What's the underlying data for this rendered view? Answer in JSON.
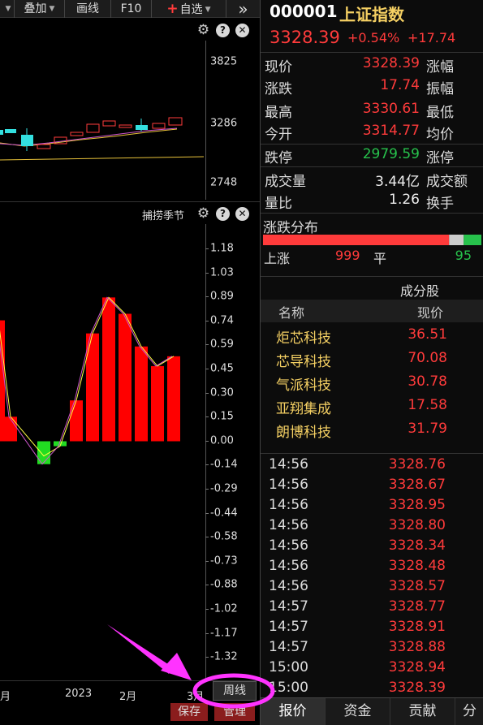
{
  "toolbar": {
    "overlay_label": "叠加",
    "draw_label": "画线",
    "f10_label": "F10",
    "watchlist_label": "自选",
    "more_glyph": "»"
  },
  "kline": {
    "price_labels": [
      "3825",
      "3286",
      "2748"
    ]
  },
  "indicator": {
    "name": "捕捞季节",
    "axis_labels": [
      "1.18",
      "1.03",
      "0.89",
      "0.74",
      "0.59",
      "0.45",
      "0.30",
      "0.15",
      "0.00",
      "-0.14",
      "-0.29",
      "-0.44",
      "-0.58",
      "-0.73",
      "-0.88",
      "-1.02",
      "-1.17",
      "-1.32"
    ]
  },
  "chart_data": {
    "type": "bar",
    "series": [
      {
        "values": [
          0.74,
          0.15,
          -0.14,
          -0.03,
          0.25,
          0.66,
          0.88,
          0.78,
          0.58,
          0.46,
          0.52
        ]
      }
    ],
    "ylim": [
      -1.32,
      1.18
    ]
  },
  "xaxis": {
    "labels": [
      "月",
      "2023",
      "2月",
      "3月"
    ]
  },
  "period_button": "周线",
  "save_button": "保存",
  "manage_button": "管理",
  "quote": {
    "code": "000001",
    "name": "上证指数",
    "price": "3328.39",
    "change_pct": "+0.54%",
    "change_amt": "+17.74",
    "rows": [
      {
        "label": "现价",
        "value": "3328.39",
        "color": "red",
        "label2": "涨幅"
      },
      {
        "label": "涨跌",
        "value": "17.74",
        "color": "red",
        "label2": "振幅"
      },
      {
        "label": "最高",
        "value": "3330.61",
        "color": "red",
        "label2": "最低"
      },
      {
        "label": "今开",
        "value": "3314.77",
        "color": "red",
        "label2": "均价"
      },
      {
        "label": "跌停",
        "value": "2979.59",
        "color": "green",
        "label2": "涨停"
      },
      {
        "label": "成交量",
        "value": "3.44亿",
        "color": "white",
        "label2": "成交额"
      },
      {
        "label": "量比",
        "value": "1.26",
        "color": "white",
        "label2": "换手"
      }
    ]
  },
  "distribution": {
    "title": "涨跌分布",
    "up_label": "上涨",
    "up_count": "999",
    "flat_label": "平",
    "down_count": "95",
    "up_color": "#ff3b3b",
    "down_color": "#27c24c"
  },
  "constituents": {
    "title": "成分股",
    "col_name": "名称",
    "col_price": "现价",
    "items": [
      {
        "name": "炬芯科技",
        "price": "36.51"
      },
      {
        "name": "芯导科技",
        "price": "70.08"
      },
      {
        "name": "气派科技",
        "price": "30.78"
      },
      {
        "name": "亚翔集成",
        "price": "17.58"
      },
      {
        "name": "朗博科技",
        "price": "31.79"
      }
    ]
  },
  "ticks": [
    {
      "time": "14:56",
      "price": "3328.76"
    },
    {
      "time": "14:56",
      "price": "3328.67"
    },
    {
      "time": "14:56",
      "price": "3328.95"
    },
    {
      "time": "14:56",
      "price": "3328.80"
    },
    {
      "time": "14:56",
      "price": "3328.34"
    },
    {
      "time": "14:56",
      "price": "3328.48"
    },
    {
      "time": "14:56",
      "price": "3328.57"
    },
    {
      "time": "14:57",
      "price": "3328.77"
    },
    {
      "time": "14:57",
      "price": "3328.91"
    },
    {
      "time": "14:57",
      "price": "3328.88"
    },
    {
      "time": "15:00",
      "price": "3328.94"
    },
    {
      "time": "15:00",
      "price": "3328.39"
    }
  ],
  "bottom_tabs": [
    "报价",
    "资金",
    "贡献",
    "分"
  ],
  "annotation": {
    "color": "#ff33ff"
  }
}
